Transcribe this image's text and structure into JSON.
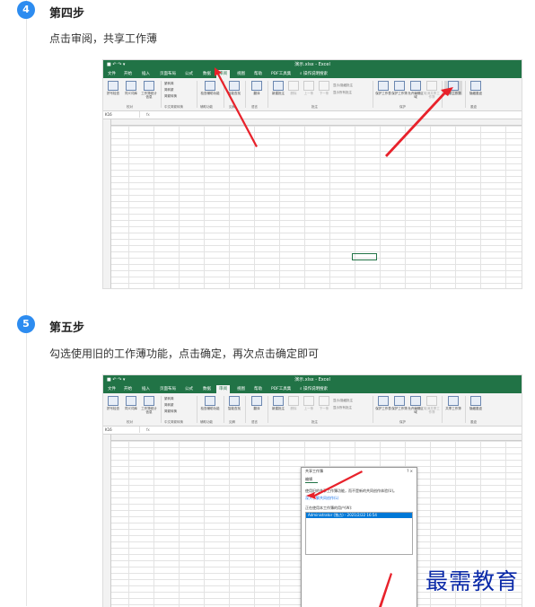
{
  "steps": [
    {
      "number": "4",
      "title": "第四步",
      "description": "点击审阅，共享工作薄"
    },
    {
      "number": "5",
      "title": "第五步",
      "description": "勾选使用旧的工作薄功能，点击确定，再次点击确定即可"
    }
  ],
  "excel": {
    "window_title": "演示.xlsx - Excel",
    "quick_access": "■ ↶ ↷ ▾",
    "tabs": [
      "文件",
      "开始",
      "插入",
      "页面布局",
      "公式",
      "数据",
      "审阅",
      "视图",
      "帮助",
      "PDF工具集",
      "⌕ 操作说明搜索"
    ],
    "active_tab": "审阅",
    "ribbon_buttons": [
      "拼写检查",
      "同义词库",
      "工作簿统计信息",
      "检查辅助功能",
      "智能查找",
      "翻译",
      "新建批注",
      "删除",
      "上一条",
      "下一条",
      "保护工作表",
      "保护工作簿",
      "允许编辑区域",
      "取消共享工作簿",
      "共享工作簿",
      "隐藏墨迹"
    ],
    "ribbon_groups": [
      "校对",
      "中文简繁转换",
      "辅助功能",
      "见解",
      "语言",
      "批注",
      "保护",
      "墨迹"
    ],
    "chinese_conv": [
      "繁转简",
      "简转繁",
      "简繁转换"
    ],
    "comment_opts": [
      "显示/隐藏批注",
      "显示所有批注"
    ],
    "name_box": "K16",
    "fx": "fx",
    "columns": [
      "A",
      "B",
      "C",
      "D",
      "E",
      "F",
      "G",
      "H",
      "I",
      "J",
      "K",
      "L",
      "M",
      "N",
      "O",
      "P",
      "Q"
    ]
  },
  "dialog": {
    "title": "共享工作簿",
    "controls": "?  ×",
    "tab": "编辑",
    "checkbox": "使用旧的共享工作簿功能，而不是新的共同创作体验(U)。",
    "link": "深入了解共同创作(L)",
    "list_label": "正在使用本工作簿的用户(W):",
    "user": "Administrator (独占) - 2021/2/22 16:54"
  },
  "watermark": "最需教育"
}
